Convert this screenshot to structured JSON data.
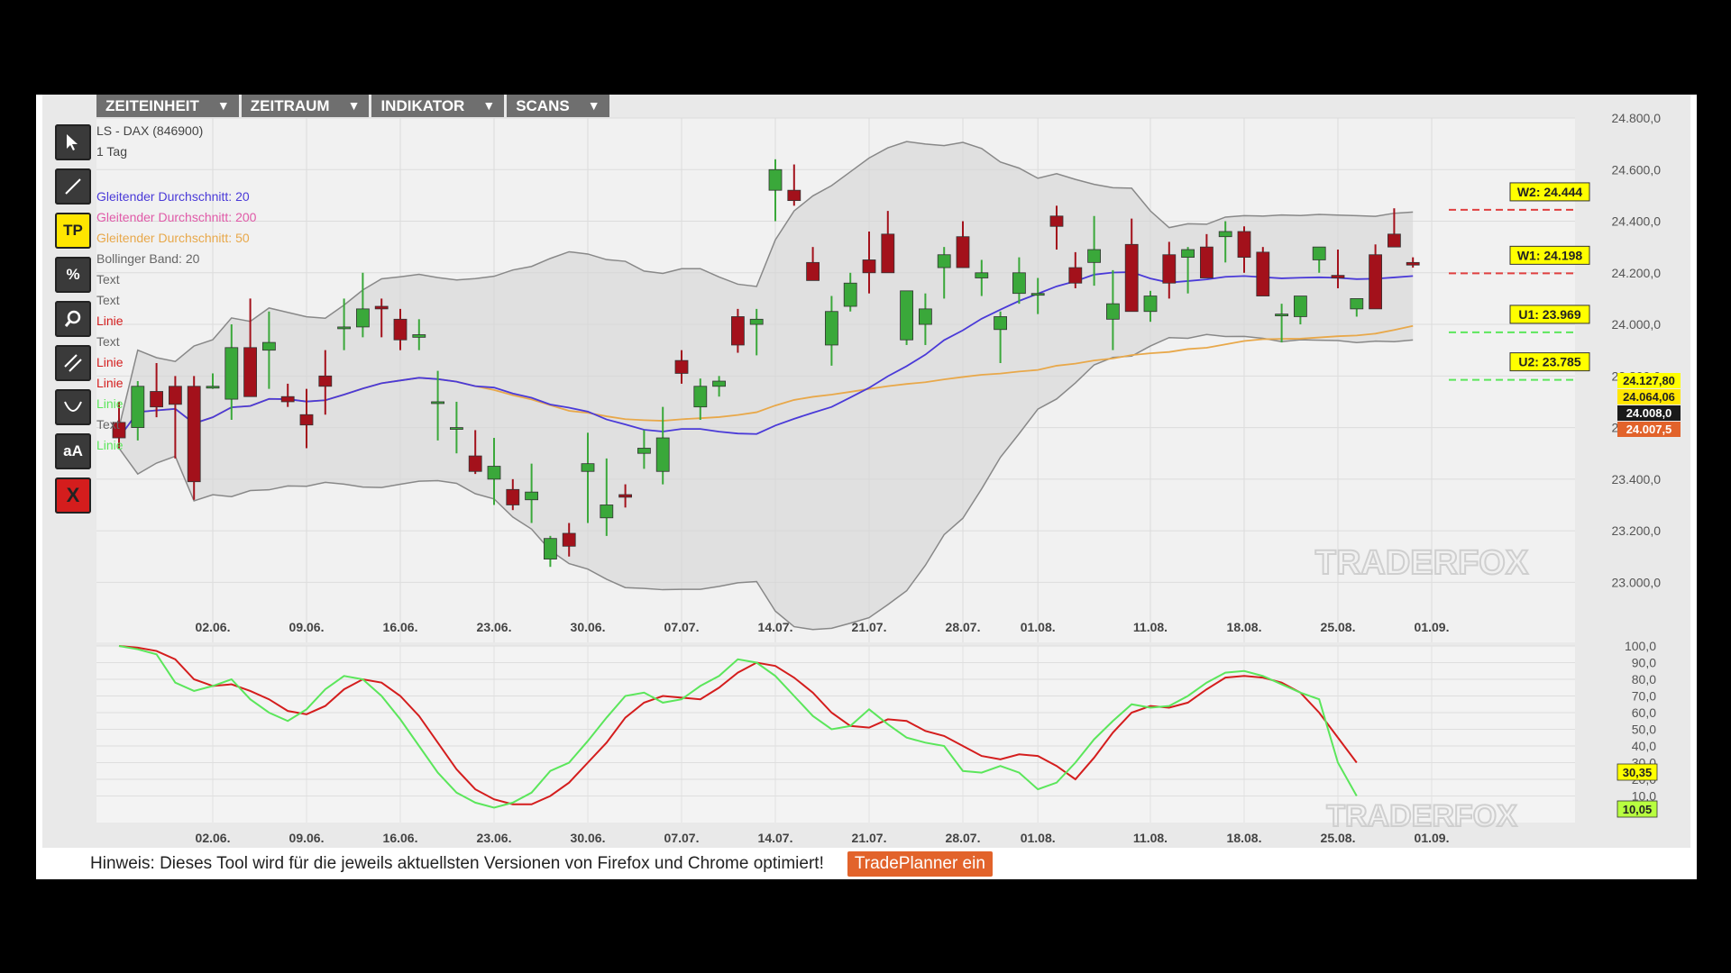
{
  "menu": [
    "ZEITEINHEIT",
    "ZEITRAUM",
    "INDIKATOR",
    "SCANS"
  ],
  "menu_arrow": "▼",
  "tools": [
    {
      "name": "pointer-tool-icon",
      "label": "",
      "style": "dark"
    },
    {
      "name": "line-tool-icon",
      "label": "",
      "style": "dark"
    },
    {
      "name": "tradeplanner-tool-button",
      "label": "TP",
      "style": "yellow"
    },
    {
      "name": "percent-tool-icon",
      "label": "%",
      "style": "dark"
    },
    {
      "name": "zoom-tool-icon",
      "label": "",
      "style": "dark"
    },
    {
      "name": "parallel-lines-tool-icon",
      "label": "",
      "style": "dark"
    },
    {
      "name": "curve-tool-icon",
      "label": "",
      "style": "dark"
    },
    {
      "name": "text-tool-button",
      "label": "aA",
      "style": "dark"
    },
    {
      "name": "delete-tool-button",
      "label": "X",
      "style": "red"
    }
  ],
  "chart_data": [
    {
      "type": "candlestick",
      "title": "LS - DAX (846900)",
      "subtitle": "1 Tag",
      "legend": [
        {
          "label": "Gleitender Durchschnitt: 20",
          "color": "#4a3ad8"
        },
        {
          "label": "Gleitender Durchschnitt: 200",
          "color": "#e05aa8"
        },
        {
          "label": "Gleitender Durchschnitt: 50",
          "color": "#e8a84a"
        },
        {
          "label": "Bollinger Band: 20",
          "color": "#666666"
        },
        {
          "label": "Text",
          "color": "#666666"
        },
        {
          "label": "Text",
          "color": "#666666"
        },
        {
          "label": "Linie",
          "color": "#d41d1d"
        },
        {
          "label": "Text",
          "color": "#666666"
        },
        {
          "label": "Linie",
          "color": "#d41d1d"
        },
        {
          "label": "Linie",
          "color": "#d41d1d"
        },
        {
          "label": "Linie",
          "color": "#5be65b"
        },
        {
          "label": "Text",
          "color": "#666666"
        },
        {
          "label": "Linie",
          "color": "#5be65b"
        }
      ],
      "ylim": [
        22900,
        24800
      ],
      "yticks": [
        "24.800,0",
        "24.600,0",
        "24.400,0",
        "24.200,0",
        "24.000,0",
        "23.800,0",
        "23.600,0",
        "23.400,0",
        "23.200,0",
        "23.000,0"
      ],
      "ytick_values": [
        24800,
        24600,
        24400,
        24200,
        24000,
        23800,
        23600,
        23400,
        23200,
        23000
      ],
      "xtick_labels": [
        "02.06.",
        "09.06.",
        "16.06.",
        "23.06.",
        "30.06.",
        "07.07.",
        "14.07.",
        "21.07.",
        "28.07.",
        "01.08.",
        "11.08.",
        "18.08.",
        "25.08.",
        "01.09."
      ],
      "xtick_index": [
        5,
        10,
        15,
        20,
        25,
        30,
        35,
        40,
        45,
        49,
        55,
        60,
        65,
        70
      ],
      "candles": [
        [
          23620,
          23700,
          23520,
          23560
        ],
        [
          23600,
          23780,
          23550,
          23760
        ],
        [
          23740,
          23850,
          23640,
          23680
        ],
        [
          23760,
          23800,
          23480,
          23690
        ],
        [
          23760,
          23800,
          23320,
          23390
        ],
        [
          23760,
          23810,
          23750,
          23760
        ],
        [
          23710,
          24000,
          23630,
          23910
        ],
        [
          23910,
          24100,
          23750,
          23720
        ],
        [
          23900,
          24050,
          23750,
          23930
        ],
        [
          23720,
          23770,
          23680,
          23700
        ],
        [
          23650,
          23750,
          23520,
          23610
        ],
        [
          23800,
          23900,
          23650,
          23760
        ],
        [
          23990,
          24100,
          23900,
          23990
        ],
        [
          23990,
          24200,
          23950,
          24060
        ],
        [
          24070,
          24100,
          23950,
          24060
        ],
        [
          24020,
          24060,
          23900,
          23940
        ],
        [
          23950,
          24020,
          23900,
          23960
        ],
        [
          23700,
          23820,
          23550,
          23700
        ],
        [
          23600,
          23700,
          23500,
          23600
        ],
        [
          23490,
          23590,
          23420,
          23430
        ],
        [
          23400,
          23560,
          23300,
          23450
        ],
        [
          23360,
          23400,
          23280,
          23300
        ],
        [
          23320,
          23460,
          23230,
          23350
        ],
        [
          23090,
          23180,
          23060,
          23170
        ],
        [
          23190,
          23230,
          23100,
          23140
        ],
        [
          23430,
          23580,
          23230,
          23460
        ],
        [
          23250,
          23480,
          23180,
          23300
        ],
        [
          23340,
          23380,
          23290,
          23330
        ],
        [
          23500,
          23590,
          23440,
          23520
        ],
        [
          23430,
          23680,
          23380,
          23560
        ],
        [
          23860,
          23900,
          23770,
          23810
        ],
        [
          23680,
          23790,
          23630,
          23760
        ],
        [
          23760,
          23800,
          23720,
          23780
        ],
        [
          24030,
          24060,
          23890,
          23920
        ],
        [
          24000,
          24060,
          23880,
          24020
        ],
        [
          24520,
          24640,
          24400,
          24600
        ],
        [
          24520,
          24620,
          24460,
          24480
        ],
        [
          24240,
          24300,
          24180,
          24170
        ],
        [
          23920,
          24110,
          23840,
          24050
        ],
        [
          24070,
          24200,
          24050,
          24160
        ],
        [
          24250,
          24360,
          24120,
          24200
        ],
        [
          24350,
          24440,
          24210,
          24200
        ],
        [
          23940,
          24100,
          23920,
          24130
        ],
        [
          24000,
          24120,
          23920,
          24060
        ],
        [
          24220,
          24300,
          24100,
          24270
        ],
        [
          24340,
          24400,
          24260,
          24220
        ],
        [
          24180,
          24250,
          24110,
          24200
        ],
        [
          23980,
          24050,
          23850,
          24030
        ],
        [
          24120,
          24260,
          24080,
          24200
        ],
        [
          24120,
          24180,
          24040,
          24120
        ],
        [
          24420,
          24460,
          24290,
          24380
        ],
        [
          24220,
          24280,
          24140,
          24160
        ],
        [
          24240,
          24420,
          24150,
          24290
        ],
        [
          24020,
          24210,
          23900,
          24080
        ],
        [
          24310,
          24410,
          24100,
          24050
        ],
        [
          24050,
          24130,
          24010,
          24110
        ],
        [
          24270,
          24320,
          24100,
          24160
        ],
        [
          24260,
          24300,
          24120,
          24290
        ],
        [
          24300,
          24350,
          24230,
          24180
        ],
        [
          24340,
          24400,
          24240,
          24360
        ],
        [
          24360,
          24380,
          24200,
          24260
        ],
        [
          24280,
          24300,
          24200,
          24110
        ],
        [
          24040,
          24080,
          23930,
          24040
        ],
        [
          24030,
          24110,
          24000,
          24110
        ],
        [
          24250,
          24280,
          24200,
          24300
        ],
        [
          24190,
          24290,
          24140,
          24180
        ],
        [
          24060,
          24080,
          24030,
          24100
        ],
        [
          24270,
          24310,
          24140,
          24060
        ],
        [
          24350,
          24450,
          24300,
          24300
        ],
        [
          24240,
          24260,
          24220,
          24230
        ]
      ],
      "annotations": [
        {
          "label": "W2: 24.444",
          "value": 24444,
          "line_color": "#e04040"
        },
        {
          "label": "W1: 24.198",
          "value": 24198,
          "line_color": "#e04040"
        },
        {
          "label": "U1: 23.969",
          "value": 23969,
          "line_color": "#5be65b"
        },
        {
          "label": "U2: 23.785",
          "value": 23785,
          "line_color": "#5be65b"
        }
      ],
      "price_labels": [
        {
          "label": "24.127,80",
          "bg": "#ffff00"
        },
        {
          "label": "24.064,06",
          "bg": "#ffe600"
        },
        {
          "label": "24.008,0",
          "bg": "#1a1a1a",
          "fg": "#ffffff"
        },
        {
          "label": "24.007,5",
          "bg": "#e2632b",
          "fg": "#ffffff"
        }
      ],
      "watermark": "TRADERFOX"
    },
    {
      "type": "line",
      "title": "",
      "ylim": [
        0,
        100
      ],
      "yticks": [
        "100,0",
        "90,0",
        "80,0",
        "70,0",
        "60,0",
        "50,0",
        "40,0",
        "30,0",
        "20,0",
        "10,0"
      ],
      "ytick_values": [
        100,
        90,
        80,
        70,
        60,
        50,
        40,
        30,
        20,
        10
      ],
      "series": [
        {
          "color": "#d41d1d",
          "values": [
            100,
            99,
            97,
            92,
            80,
            76,
            77,
            73,
            68,
            61,
            59,
            64,
            74,
            80,
            78,
            70,
            58,
            42,
            26,
            14,
            8,
            5,
            5,
            10,
            18,
            30,
            42,
            57,
            66,
            70,
            69,
            68,
            75,
            84,
            90,
            88,
            81,
            72,
            60,
            52,
            51,
            56,
            55,
            49,
            46,
            40,
            34,
            32,
            35,
            34,
            28,
            20,
            33,
            48,
            60,
            64,
            63,
            66,
            74,
            81,
            82,
            81,
            78,
            72,
            60,
            45,
            30
          ]
        },
        {
          "color": "#5be65b",
          "values": [
            100,
            98,
            95,
            78,
            73,
            76,
            80,
            68,
            60,
            55,
            62,
            74,
            82,
            80,
            70,
            56,
            40,
            24,
            12,
            6,
            3,
            6,
            12,
            25,
            30,
            43,
            57,
            70,
            72,
            66,
            68,
            76,
            82,
            92,
            90,
            82,
            70,
            58,
            50,
            52,
            62,
            53,
            45,
            42,
            40,
            25,
            24,
            28,
            24,
            14,
            18,
            30,
            44,
            55,
            65,
            63,
            64,
            70,
            78,
            84,
            85,
            82,
            77,
            72,
            68,
            30,
            10
          ]
        }
      ],
      "value_labels": [
        {
          "label": "30,35",
          "bg": "#ffff00"
        },
        {
          "label": "10,05",
          "bg": "#b8ff40"
        }
      ],
      "xtick_labels": [
        "02.06.",
        "09.06.",
        "16.06.",
        "23.06.",
        "30.06.",
        "07.07.",
        "14.07.",
        "21.07.",
        "28.07.",
        "01.08.",
        "11.08.",
        "18.08.",
        "25.08.",
        "01.09."
      ],
      "watermark": "TRADERFOX"
    }
  ],
  "footer": {
    "hint": "Hinweis: Dieses Tool wird für die jeweils aktuellsten Versionen von Firefox und Chrome optimiert!",
    "button": "TradePlanner ein"
  },
  "colors": {
    "up": "#3aa83a",
    "down": "#a3111b",
    "accent": "#e2632b"
  }
}
